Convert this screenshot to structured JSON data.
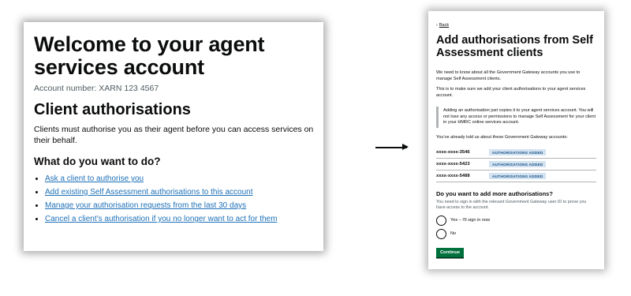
{
  "left": {
    "title": "Welcome to your agent services account",
    "account_number": "Account number: XARN 123 4567",
    "section_heading": "Client authorisations",
    "body": "Clients must authorise you as their agent before you can access services on their behalf.",
    "question_heading": "What do you want to do?",
    "links": [
      "Ask a client to authorise you",
      "Add existing Self Assessment authorisations to this account",
      "Manage your authorisation requests from the last 30 days",
      "Cancel a client’s authorisation if you no longer want to act for them"
    ]
  },
  "right": {
    "back_label": "Back",
    "title": "Add authorisations from Self Assessment clients",
    "para1": "We need to know about all the Government Gateway accounts you use to manage Self Assessment clients.",
    "para2": "This is to make sure we add your client authorisations to your agent services account.",
    "inset": "Adding an authorisation just copies it to your agent services account. You will not lose any access or permissions to manage Self Assessment for your client in your HMRC online services account.",
    "accounts_intro": "You’ve already told us about these Government Gateway accounts:",
    "accounts": [
      {
        "number": "xxxx-xxxx-3546",
        "status": "AUTHORISATIONS ADDED"
      },
      {
        "number": "xxxx-xxxx-5423",
        "status": "AUTHORISATIONS ADDED"
      },
      {
        "number": "xxxx-xxxx-5488",
        "status": "AUTHORISATIONS ADDED"
      }
    ],
    "question": "Do you want to add more authorisations?",
    "hint": "You need to sign in with the relevant Government Gateway user ID to prove you have access to the account.",
    "options": [
      "Yes – I’ll sign in now",
      "No"
    ],
    "continue_label": "Continue"
  },
  "colors": {
    "link": "#1d70b8",
    "button_green": "#00703c",
    "tag_background": "#d2e2f1",
    "tag_text": "#144e81",
    "inset_border": "#b1b4b6"
  },
  "icons": {
    "back": "chevron-left-icon",
    "transition": "arrow-right-icon"
  }
}
